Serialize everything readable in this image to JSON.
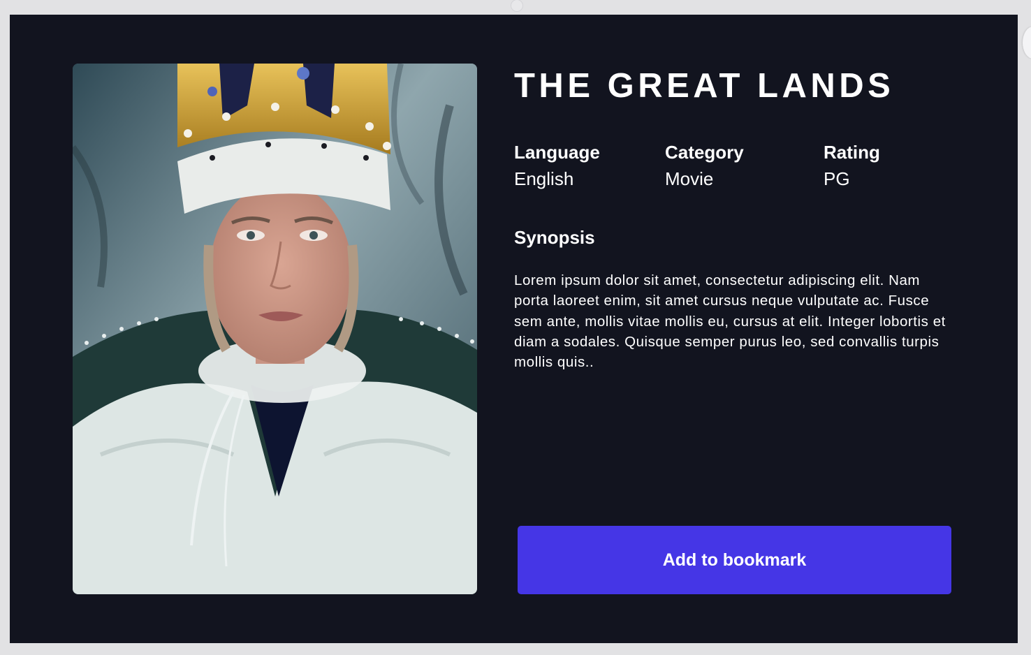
{
  "movie": {
    "title": "THE GREAT LANDS",
    "poster_icon": "portrait-image"
  },
  "meta": {
    "language": {
      "label": "Language",
      "value": "English"
    },
    "category": {
      "label": "Category",
      "value": "Movie"
    },
    "rating": {
      "label": "Rating",
      "value": "PG"
    }
  },
  "synopsis": {
    "heading": "Synopsis",
    "text": "Lorem ipsum dolor sit amet, consectetur adipiscing elit. Nam porta laoreet enim, sit amet cursus neque vulputate ac. Fusce sem ante, mollis vitae mollis eu, cursus at elit. Integer lobortis et diam a sodales. Quisque semper purus leo, sed convallis turpis mollis quis.."
  },
  "actions": {
    "bookmark_label": "Add to bookmark"
  },
  "colors": {
    "card_background": "#12141f",
    "accent": "#4536e6",
    "text": "#ffffff"
  }
}
